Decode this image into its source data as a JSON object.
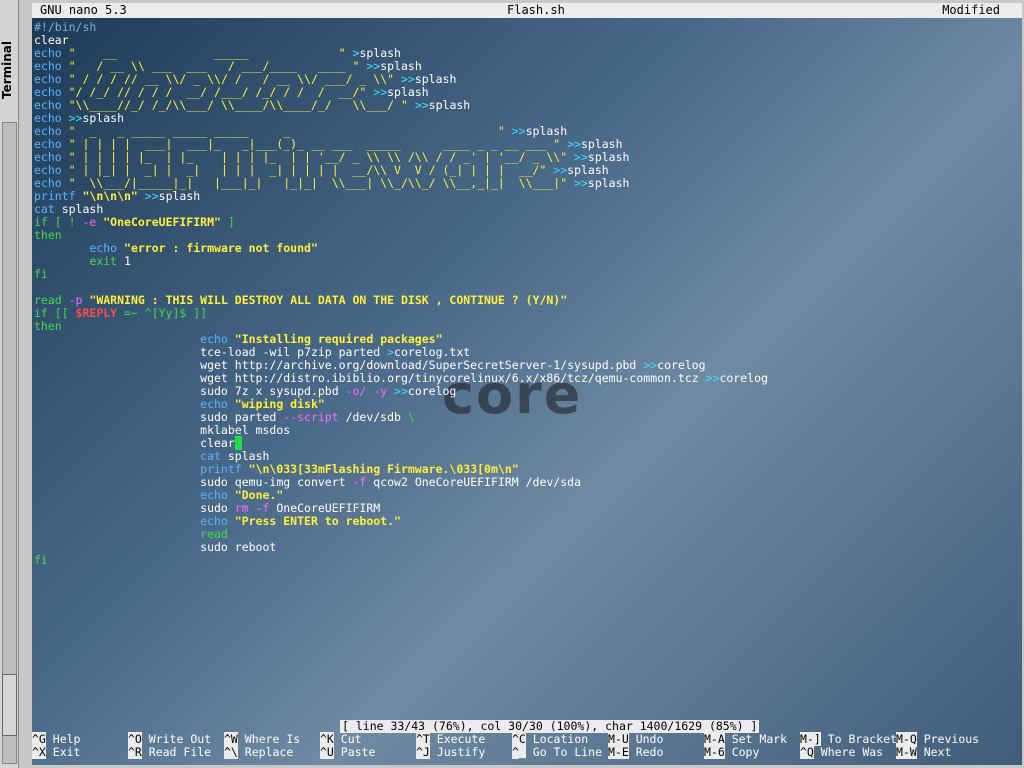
{
  "side_panel": {
    "label": "Terminal"
  },
  "editor": {
    "app": "GNU nano 5.3",
    "file": "Flash.sh",
    "state": "Modified",
    "watermark": "core",
    "lines": [
      [
        [
          "#!/bin/sh",
          "mut"
        ]
      ],
      [
        [
          "clear",
          ""
        ]
      ],
      [
        [
          "echo ",
          "kw"
        ],
        [
          "\"    __              _____             \" ",
          "tl"
        ],
        [
          ">",
          "cm"
        ],
        [
          "splash",
          ""
        ]
      ],
      [
        [
          "echo ",
          "kw"
        ],
        [
          "\"   / __ \\\\ ___  ___   / ___/____   ____ \" ",
          "tl"
        ],
        [
          ">>",
          "cm"
        ],
        [
          "splash",
          ""
        ]
      ],
      [
        [
          "echo ",
          "kw"
        ],
        [
          "\" / / / // __ \\\\/ _ \\\\/ /   / __ \\\\/ ___/ _ \\\\\" ",
          "tl"
        ],
        [
          ">>",
          "cm"
        ],
        [
          "splash",
          ""
        ]
      ],
      [
        [
          "echo ",
          "kw"
        ],
        [
          "\"/ /_/ // / / /  __/ /___/ /_/ / /  /  __/\" ",
          "tl"
        ],
        [
          ">>",
          "cm"
        ],
        [
          "splash",
          ""
        ]
      ],
      [
        [
          "echo ",
          "kw"
        ],
        [
          "\"\\\\____//_/ /_/\\\\___/ \\\\____/\\\\____/_/   \\\\___/ \" ",
          "tl"
        ],
        [
          ">>",
          "cm"
        ],
        [
          "splash",
          ""
        ]
      ],
      [
        [
          "echo ",
          "kw"
        ],
        [
          ">>",
          "cm"
        ],
        [
          "splash",
          ""
        ]
      ],
      [
        [
          "echo ",
          "kw"
        ],
        [
          "\"  _   _ _____ _____ _____     _                              \" ",
          "tl"
        ],
        [
          ">>",
          "cm"
        ],
        [
          "splash",
          ""
        ]
      ],
      [
        [
          "echo ",
          "kw"
        ],
        [
          "\" | | | |  ___|  ___|_   _|___(_)_ __ ___  _____      ____ _ _ __ ___ \" ",
          "tl"
        ],
        [
          ">>",
          "cm"
        ],
        [
          "splash",
          ""
        ]
      ],
      [
        [
          "echo ",
          "kw"
        ],
        [
          "\" | | | | |_  | |_    | | | |_  | | '__/ _ \\\\ \\\\ /\\\\ / / _' | '__/ _ \\\\\" ",
          "tl"
        ],
        [
          ">>",
          "cm"
        ],
        [
          "splash",
          ""
        ]
      ],
      [
        [
          "echo ",
          "kw"
        ],
        [
          "\" | |_| |  _| |  _|   | | |  _| | | | |  __/\\\\ V  V / (_| | | |  __/\" ",
          "tl"
        ],
        [
          ">>",
          "cm"
        ],
        [
          "splash",
          ""
        ]
      ],
      [
        [
          "echo ",
          "kw"
        ],
        [
          "\"  \\\\___/|_____|_|   |___|_|   |_|_|  \\\\___| \\\\_/\\\\_/ \\\\__,_|_|  \\\\___|\" ",
          "tl"
        ],
        [
          ">>",
          "cm"
        ],
        [
          "splash",
          ""
        ]
      ],
      [
        [
          "printf ",
          "kw"
        ],
        [
          "\"\\n\\n\\n\" ",
          "str"
        ],
        [
          ">>",
          "cm"
        ],
        [
          "splash",
          ""
        ]
      ],
      [
        [
          "cat ",
          "kw"
        ],
        [
          "splash",
          ""
        ]
      ],
      [
        [
          "if [ ! ",
          "grn"
        ],
        [
          "-e ",
          "purp"
        ],
        [
          "\"OneCoreUEFIFIRM\"",
          "str"
        ],
        [
          " ]",
          "grn"
        ]
      ],
      [
        [
          "then",
          "grn"
        ]
      ],
      [
        [
          "        echo ",
          "kw"
        ],
        [
          "\"error : firmware not found\"",
          "str"
        ]
      ],
      [
        [
          "        exit ",
          "grn"
        ],
        [
          "1",
          ""
        ]
      ],
      [
        [
          "fi",
          "grn"
        ]
      ],
      [
        [
          "",
          ""
        ]
      ],
      [
        [
          "read ",
          "grn"
        ],
        [
          "-p ",
          "purp"
        ],
        [
          "\"WARNING : THIS WILL DESTROY ALL DATA ON THE DISK , CONTINUE ? (Y/N)\"",
          "str"
        ]
      ],
      [
        [
          "if [[ ",
          "grn"
        ],
        [
          "$REPLY",
          "red"
        ],
        [
          " =~ ^[Yy]$ ]]",
          "grn"
        ]
      ],
      [
        [
          "then",
          "grn"
        ]
      ],
      [
        [
          "                        echo ",
          "kw"
        ],
        [
          "\"Installing required packages\"",
          "str"
        ]
      ],
      [
        [
          "                        tce-load -wil p7zip parted ",
          ""
        ],
        [
          ">",
          "cm"
        ],
        [
          "corelog.txt",
          ""
        ]
      ],
      [
        [
          "                        wget http://archive.org/download/SuperSecretServer-1/sysupd.pbd ",
          ""
        ],
        [
          ">>",
          "cm"
        ],
        [
          "corelog",
          ""
        ]
      ],
      [
        [
          "                        wget http://distro.ibiblio.org/tinycorelinux/6.x/x86/tcz/qemu-common.tcz ",
          ""
        ],
        [
          ">>",
          "cm"
        ],
        [
          "corelog",
          ""
        ]
      ],
      [
        [
          "                        sudo 7z x sysupd.pbd ",
          ""
        ],
        [
          "-o/ -y ",
          "purp"
        ],
        [
          ">>",
          "cm"
        ],
        [
          "corelog",
          ""
        ]
      ],
      [
        [
          "                        echo ",
          "kw"
        ],
        [
          "\"wiping disk\"",
          "str"
        ]
      ],
      [
        [
          "                        sudo parted ",
          ""
        ],
        [
          "--script ",
          "purp"
        ],
        [
          "/dev/sdb ",
          ""
        ],
        [
          "\\",
          "grn"
        ]
      ],
      [
        [
          "                        mklabel msdos",
          ""
        ]
      ],
      [
        [
          "                        clear",
          ""
        ],
        [
          "X",
          "cursor"
        ]
      ],
      [
        [
          "                        cat ",
          "kw"
        ],
        [
          "splash",
          ""
        ]
      ],
      [
        [
          "                        printf ",
          "kw"
        ],
        [
          "\"\\n\\033[33mFlashing Firmware.\\033[0m\\n\"",
          "str"
        ]
      ],
      [
        [
          "                        sudo qemu-img convert ",
          ""
        ],
        [
          "-f ",
          "purp"
        ],
        [
          "qcow2 OneCoreUEFIFIRM /dev/sda",
          ""
        ]
      ],
      [
        [
          "                        echo ",
          "kw"
        ],
        [
          "\"Done.\"",
          "str"
        ]
      ],
      [
        [
          "                        sudo ",
          ""
        ],
        [
          "rm -f ",
          "purp"
        ],
        [
          "OneCoreUEFIFIRM",
          ""
        ]
      ],
      [
        [
          "                        echo ",
          "kw"
        ],
        [
          "\"Press ENTER to reboot.\"",
          "str"
        ]
      ],
      [
        [
          "                        read",
          "grn"
        ]
      ],
      [
        [
          "                        sudo reboot",
          ""
        ]
      ],
      [
        [
          "fi",
          "grn"
        ]
      ]
    ],
    "status": "[ line 33/43 (76%), col 30/30 (100%), char 1400/1629 (85%) ]"
  },
  "shortcuts": [
    {
      "key": "^G",
      "label": "Help"
    },
    {
      "key": "^X",
      "label": "Exit"
    },
    {
      "key": "^O",
      "label": "Write Out"
    },
    {
      "key": "^R",
      "label": "Read File"
    },
    {
      "key": "^W",
      "label": "Where Is"
    },
    {
      "key": "^\\",
      "label": "Replace"
    },
    {
      "key": "^K",
      "label": "Cut"
    },
    {
      "key": "^U",
      "label": "Paste"
    },
    {
      "key": "^T",
      "label": "Execute"
    },
    {
      "key": "^J",
      "label": "Justify"
    },
    {
      "key": "^C",
      "label": "Location"
    },
    {
      "key": "^_",
      "label": "Go To Line"
    },
    {
      "key": "M-U",
      "label": "Undo"
    },
    {
      "key": "M-E",
      "label": "Redo"
    },
    {
      "key": "M-A",
      "label": "Set Mark"
    },
    {
      "key": "M-6",
      "label": "Copy"
    },
    {
      "key": "M-]",
      "label": "To Bracket"
    },
    {
      "key": "^Q",
      "label": "Where Was"
    },
    {
      "key": "M-Q",
      "label": "Previous"
    },
    {
      "key": "M-W",
      "label": "Next"
    }
  ]
}
